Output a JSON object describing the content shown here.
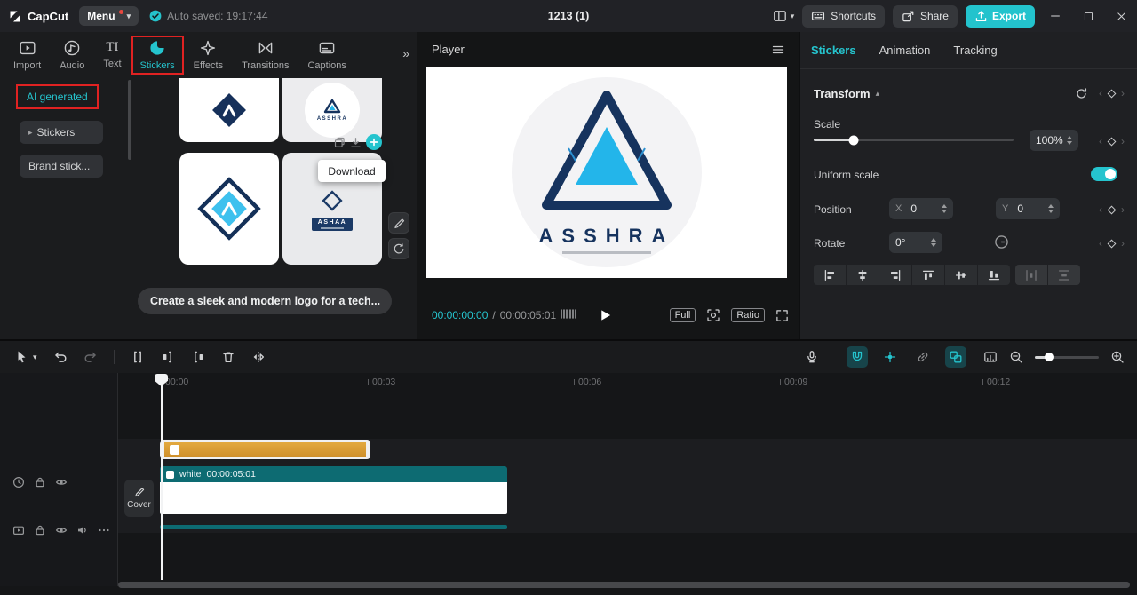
{
  "colors": {
    "accent": "#25c4ce",
    "annotation_red": "#e02222",
    "sticker_clip_orange": "#d8992f",
    "video_clip_teal": "#0d6b72"
  },
  "glyphs": {
    "caret_down": "▾",
    "double_chevron": "»",
    "sidebar_arrow": "▸",
    "collapse_up": "▴",
    "kf_prev": "‹",
    "kf_next": "›",
    "text_tab_icon": "TI",
    "slash": "/"
  },
  "titlebar": {
    "app_name": "CapCut",
    "menu_label": "Menu",
    "autosave_text": "Auto saved: 19:17:44",
    "project_title": "1213 (1)",
    "shortcuts_label": "Shortcuts",
    "share_label": "Share",
    "export_label": "Export"
  },
  "media_panel": {
    "tabs": [
      {
        "label": "Import"
      },
      {
        "label": "Audio"
      },
      {
        "label": "Text"
      },
      {
        "label": "Stickers"
      },
      {
        "label": "Effects"
      },
      {
        "label": "Transitions"
      },
      {
        "label": "Captions"
      }
    ],
    "sidebar": [
      {
        "label": "AI generated"
      },
      {
        "label": "Stickers"
      },
      {
        "label": "Brand stick..."
      }
    ],
    "thumb_logo_text": "ASSHRA",
    "thumb_logo_text_2": "ASHAA",
    "download_tooltip": "Download",
    "prompt_text": "Create a sleek and modern logo for a tech..."
  },
  "player": {
    "title": "Player",
    "logo_text": "ASSHRA",
    "time_current": "00:00:00:00",
    "time_duration": "00:00:05:01",
    "full_label": "Full",
    "ratio_label": "Ratio"
  },
  "inspector": {
    "tabs": [
      {
        "label": "Stickers"
      },
      {
        "label": "Animation"
      },
      {
        "label": "Tracking"
      }
    ],
    "transform_title": "Transform",
    "scale_label": "Scale",
    "scale_value": "100%",
    "uniform_scale_label": "Uniform scale",
    "position_label": "Position",
    "x_label": "X",
    "x_value": "0",
    "y_label": "Y",
    "y_value": "0",
    "rotate_label": "Rotate",
    "rotate_value": "0°"
  },
  "timeline": {
    "ruler_ticks": [
      "00:00",
      "00:03",
      "00:06",
      "00:09",
      "00:12"
    ],
    "cover_label": "Cover",
    "video_clip_label": "white",
    "video_clip_duration": "00:00:05:01"
  }
}
